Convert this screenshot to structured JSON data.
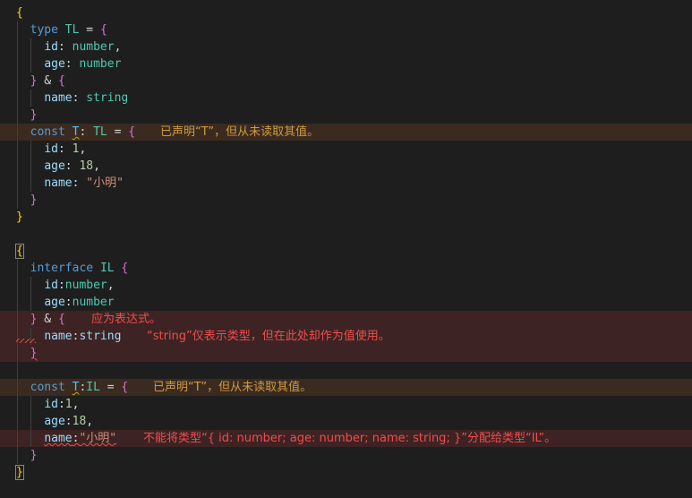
{
  "editor": {
    "lines": [
      [
        {
          "t": "{",
          "c": "b-gold"
        }
      ],
      [
        {
          "t": "  "
        },
        {
          "t": "type",
          "c": "kw"
        },
        {
          "t": " "
        },
        {
          "t": "TL",
          "c": "ty"
        },
        {
          "t": " = ",
          "c": "pu"
        },
        {
          "t": "{",
          "c": "b-pink"
        }
      ],
      [
        {
          "t": "    "
        },
        {
          "t": "id",
          "c": "pr"
        },
        {
          "t": ": ",
          "c": "pu"
        },
        {
          "t": "number",
          "c": "ty"
        },
        {
          "t": ",",
          "c": "pu"
        }
      ],
      [
        {
          "t": "    "
        },
        {
          "t": "age",
          "c": "pr"
        },
        {
          "t": ": ",
          "c": "pu"
        },
        {
          "t": "number",
          "c": "ty"
        }
      ],
      [
        {
          "t": "  "
        },
        {
          "t": "}",
          "c": "b-pink"
        },
        {
          "t": " & ",
          "c": "pu"
        },
        {
          "t": "{",
          "c": "b-pink"
        }
      ],
      [
        {
          "t": "    "
        },
        {
          "t": "name",
          "c": "pr"
        },
        {
          "t": ": ",
          "c": "pu"
        },
        {
          "t": "string",
          "c": "ty"
        }
      ],
      [
        {
          "t": "  "
        },
        {
          "t": "}",
          "c": "b-pink"
        }
      ],
      [
        {
          "t": "  "
        },
        {
          "t": "const",
          "c": "kw"
        },
        {
          "t": " "
        },
        {
          "t": "T",
          "c": "tn squig-info"
        },
        {
          "t": ": ",
          "c": "pu"
        },
        {
          "t": "TL",
          "c": "ty"
        },
        {
          "t": " = ",
          "c": "pu"
        },
        {
          "t": "{",
          "c": "b-pink"
        }
      ],
      [
        {
          "t": "    "
        },
        {
          "t": "id",
          "c": "pr"
        },
        {
          "t": ": ",
          "c": "pu"
        },
        {
          "t": "1",
          "c": "nm"
        },
        {
          "t": ",",
          "c": "pu"
        }
      ],
      [
        {
          "t": "    "
        },
        {
          "t": "age",
          "c": "pr"
        },
        {
          "t": ": ",
          "c": "pu"
        },
        {
          "t": "18",
          "c": "nm"
        },
        {
          "t": ",",
          "c": "pu"
        }
      ],
      [
        {
          "t": "    "
        },
        {
          "t": "name",
          "c": "pr"
        },
        {
          "t": ": ",
          "c": "pu"
        },
        {
          "t": "\"小明\"",
          "c": "st"
        }
      ],
      [
        {
          "t": "  "
        },
        {
          "t": "}",
          "c": "b-pink"
        }
      ],
      [
        {
          "t": "}",
          "c": "b-gold"
        }
      ],
      [],
      [
        {
          "t": "{",
          "c": "b-gold bracket-box"
        }
      ],
      [
        {
          "t": "  "
        },
        {
          "t": "interface",
          "c": "kw"
        },
        {
          "t": " "
        },
        {
          "t": "IL",
          "c": "ty"
        },
        {
          "t": " "
        },
        {
          "t": "{",
          "c": "b-pink"
        }
      ],
      [
        {
          "t": "    "
        },
        {
          "t": "id",
          "c": "pr"
        },
        {
          "t": ":",
          "c": "pu"
        },
        {
          "t": "number",
          "c": "ty"
        },
        {
          "t": ",",
          "c": "pu"
        }
      ],
      [
        {
          "t": "    "
        },
        {
          "t": "age",
          "c": "pr"
        },
        {
          "t": ":",
          "c": "pu"
        },
        {
          "t": "number",
          "c": "ty"
        }
      ],
      [
        {
          "t": "  "
        },
        {
          "t": "}",
          "c": "b-pink"
        },
        {
          "t": " & ",
          "c": "pu"
        },
        {
          "t": "{",
          "c": "b-pink"
        }
      ],
      [
        {
          "t": "    "
        },
        {
          "t": "name",
          "c": "pr"
        },
        {
          "t": ":",
          "c": "pu"
        },
        {
          "t": "string",
          "c": "pr"
        }
      ],
      [
        {
          "t": "  "
        },
        {
          "t": "}",
          "c": "b-pink squig-err"
        }
      ],
      [],
      [
        {
          "t": "  "
        },
        {
          "t": "const",
          "c": "kw"
        },
        {
          "t": " "
        },
        {
          "t": "T",
          "c": "tn squig-info"
        },
        {
          "t": ":",
          "c": "pu"
        },
        {
          "t": "IL",
          "c": "ty"
        },
        {
          "t": " = ",
          "c": "pu"
        },
        {
          "t": "{",
          "c": "b-pink"
        }
      ],
      [
        {
          "t": "    "
        },
        {
          "t": "id",
          "c": "pr"
        },
        {
          "t": ":",
          "c": "pu"
        },
        {
          "t": "1",
          "c": "nm"
        },
        {
          "t": ",",
          "c": "pu"
        }
      ],
      [
        {
          "t": "    "
        },
        {
          "t": "age",
          "c": "pr"
        },
        {
          "t": ":",
          "c": "pu"
        },
        {
          "t": "18",
          "c": "nm"
        },
        {
          "t": ",",
          "c": "pu"
        }
      ],
      [
        {
          "t": "    "
        },
        {
          "t": "name",
          "c": "pr squig-err"
        },
        {
          "t": ":",
          "c": "pu squig-err"
        },
        {
          "t": "\"小明\"",
          "c": "st squig-err"
        }
      ],
      [
        {
          "t": "  "
        },
        {
          "t": "}",
          "c": "b-pink"
        }
      ],
      [
        {
          "t": "}",
          "c": "b-gold bracket-box"
        }
      ]
    ],
    "guides": [
      [],
      [
        1
      ],
      [
        1,
        2
      ],
      [
        1,
        2
      ],
      [
        1
      ],
      [
        1,
        2
      ],
      [
        1
      ],
      [
        1
      ],
      [
        1,
        2
      ],
      [
        1,
        2
      ],
      [
        1,
        2
      ],
      [
        1
      ],
      [],
      [],
      [],
      [
        1
      ],
      [
        1,
        2
      ],
      [
        1,
        2
      ],
      [
        1
      ],
      [
        1,
        2
      ],
      [
        1
      ],
      [
        1
      ],
      [
        1
      ],
      [
        1,
        2
      ],
      [
        1,
        2
      ],
      [
        1,
        2
      ],
      [
        1
      ],
      []
    ],
    "highlights": {
      "7": "hl-info",
      "18": "hl-error",
      "19": "hl-error",
      "20": "hl-error",
      "22": "hl-info",
      "25": "hl-error"
    },
    "diagnostics": [
      {
        "line": 7,
        "severity": "info",
        "text": "已声明“T”，但从未读取其值。"
      },
      {
        "line": 18,
        "severity": "error",
        "text": "应为表达式。"
      },
      {
        "line": 19,
        "severity": "error",
        "text": "“string”仅表示类型，但在此处却作为值使用。"
      },
      {
        "line": 22,
        "severity": "info",
        "text": "已声明“T”，但从未读取其值。"
      },
      {
        "line": 25,
        "severity": "error",
        "text": "不能将类型“{ id: number; age: number; name: string; }”分配给类型“IL”。"
      }
    ]
  }
}
